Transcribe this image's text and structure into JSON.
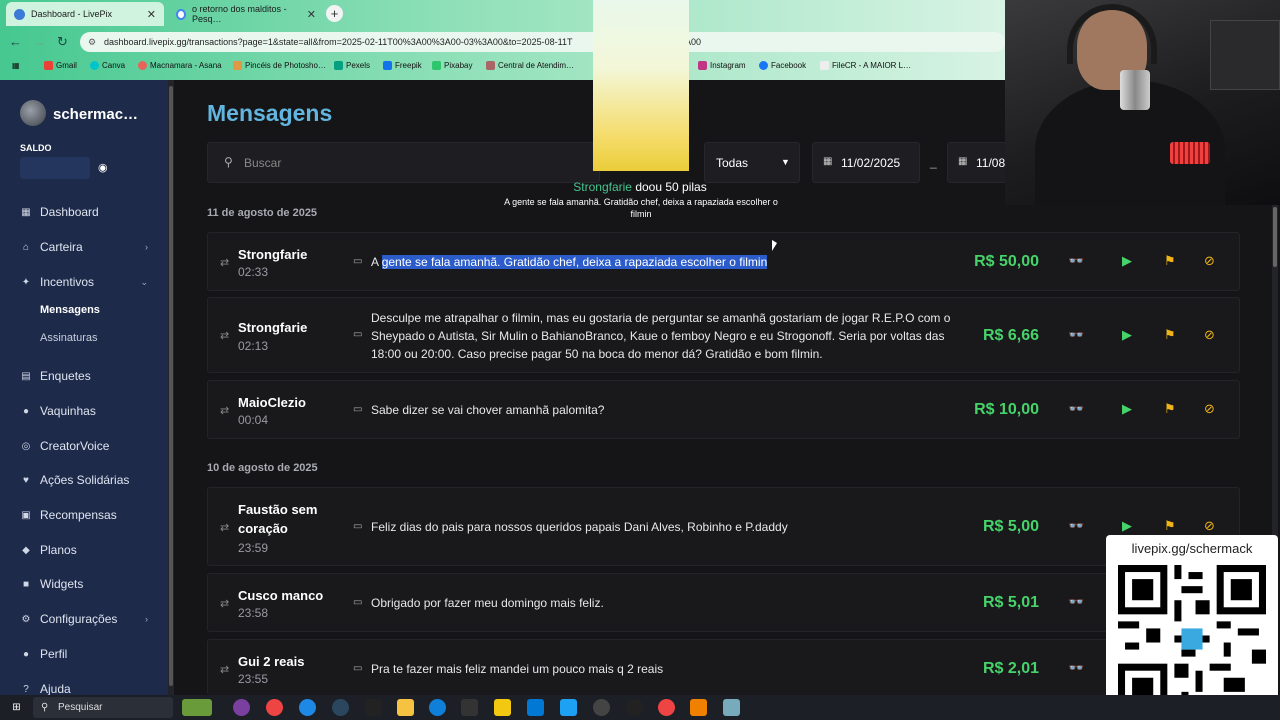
{
  "browser": {
    "tabs": [
      {
        "title": "Dashboard - LivePix",
        "active": true
      },
      {
        "title": "o retorno dos malditos - Pesq…",
        "active": false
      }
    ],
    "url_visible_start": "dashboard.livepix.gg/transactions?page=1&state=all&from=2025-02-11T00%3A00%3A00-03%3A00&to=2025-08-11T",
    "url_visible_end": "A00",
    "bookmarks": [
      "Gmail",
      "Canva",
      "Macnamara - Asana",
      "Pincéis de Photosho…",
      "Pexels",
      "Freepik",
      "Pixabay",
      "Central de Atendim…",
      "Instagram",
      "Facebook",
      "FileCR - A MAIOR L…"
    ]
  },
  "sidebar": {
    "username": "schermac…",
    "saldo_label": "SALDO",
    "items": [
      {
        "label": "Dashboard",
        "icon": "grid-icon"
      },
      {
        "label": "Carteira",
        "icon": "bank-icon",
        "chevron": "›"
      },
      {
        "label": "Incentivos",
        "icon": "sparkle-icon",
        "chevron": "⌄"
      },
      {
        "label": "Enquetes",
        "icon": "poll-icon"
      },
      {
        "label": "Vaquinhas",
        "icon": "piggy-icon"
      },
      {
        "label": "CreatorVoice",
        "icon": "voice-icon"
      },
      {
        "label": "Ações Solidárias",
        "icon": "heart-icon"
      },
      {
        "label": "Recompensas",
        "icon": "gift-icon"
      },
      {
        "label": "Planos",
        "icon": "plans-icon"
      },
      {
        "label": "Widgets",
        "icon": "widgets-icon"
      },
      {
        "label": "Configurações",
        "icon": "gear-icon",
        "chevron": "›"
      },
      {
        "label": "Perfil",
        "icon": "user-icon"
      },
      {
        "label": "Ajuda",
        "icon": "help-icon"
      }
    ],
    "subitems": [
      {
        "label": "Mensagens",
        "active": true
      },
      {
        "label": "Assinaturas",
        "active": false
      }
    ]
  },
  "main": {
    "title": "Mensagens",
    "search_placeholder": "Buscar",
    "filter_value": "Todas",
    "date_from": "11/02/2025",
    "date_sep": "_",
    "date_to": "11/08",
    "groups": [
      {
        "date": "11 de agosto de 2025",
        "rows": [
          {
            "name": "Strongfarie",
            "time": "02:33",
            "msg_prefix": "A ",
            "msg_highlight": "gente se fala amanhã. Gratidão chef, deixa a rapaziada escolher o filmin",
            "amount": "R$ 50,00"
          },
          {
            "name": "Strongfarie",
            "time": "02:13",
            "msg": "Desculpe me atrapalhar o filmin, mas eu gostaria de perguntar se amanhã gostariam de jogar R.E.P.O com o Sheypado o Autista, Sir Mulin o BahianoBranco, Kaue o femboy Negro e eu Strogonoff. Seria por voltas das 18:00 ou 20:00. Caso precise pagar 50 na boca do menor dá? Gratidão e bom filmin.",
            "amount": "R$ 6,66"
          },
          {
            "name": "MaioClezio",
            "time": "00:04",
            "msg": "Sabe dizer se vai chover amanhã palomita?",
            "amount": "R$ 10,00"
          }
        ]
      },
      {
        "date": "10 de agosto de 2025",
        "rows": [
          {
            "name": "Faustão sem coração",
            "time": "23:59",
            "msg": "Feliz dias do pais para nossos queridos papais Dani Alves, Robinho e P.daddy",
            "amount": "R$ 5,00"
          },
          {
            "name": "Cusco manco",
            "time": "23:58",
            "msg": "Obrigado por fazer meu domingo mais feliz.",
            "amount": "R$ 5,01"
          },
          {
            "name": "Gui 2 reais",
            "time": "23:55",
            "msg": "Pra te fazer mais feliz mandei um pouco mais q 2 reais",
            "amount": "R$ 2,01"
          }
        ]
      }
    ]
  },
  "alert": {
    "name": "Strongfarie",
    "action": " doou 50 pilas",
    "message": "A gente se fala amanhã. Gratidão chef, deixa a rapaziada escolher o filmin"
  },
  "qr": {
    "label": "livepix.gg/schermack"
  },
  "taskbar": {
    "search_label": "Pesquisar"
  },
  "colors": {
    "accent": "#62b5de",
    "amount": "#46d36a",
    "sidebar": "#1d2a4a",
    "flag": "#f0b418"
  }
}
